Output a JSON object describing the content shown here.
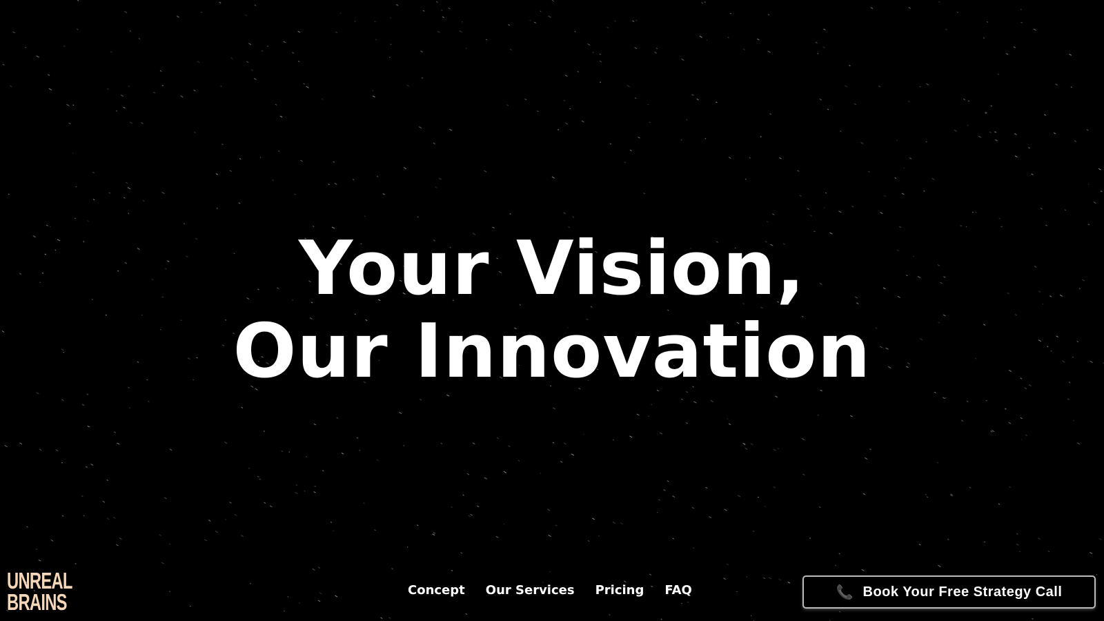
{
  "hero": {
    "line1": "Your Vision,",
    "line2": "Our Innovation"
  },
  "logo": {
    "line1": "UNREAL",
    "line2": "BRAINS"
  },
  "nav": {
    "items": [
      {
        "label": "Concept"
      },
      {
        "label": "Our Services"
      },
      {
        "label": "Pricing"
      },
      {
        "label": "FAQ"
      }
    ]
  },
  "cta": {
    "icon": "phone-icon",
    "label": "Book Your Free Strategy Call"
  },
  "colors": {
    "background": "#000000",
    "logo": "#f6d6b8",
    "text": "#ffffff"
  }
}
